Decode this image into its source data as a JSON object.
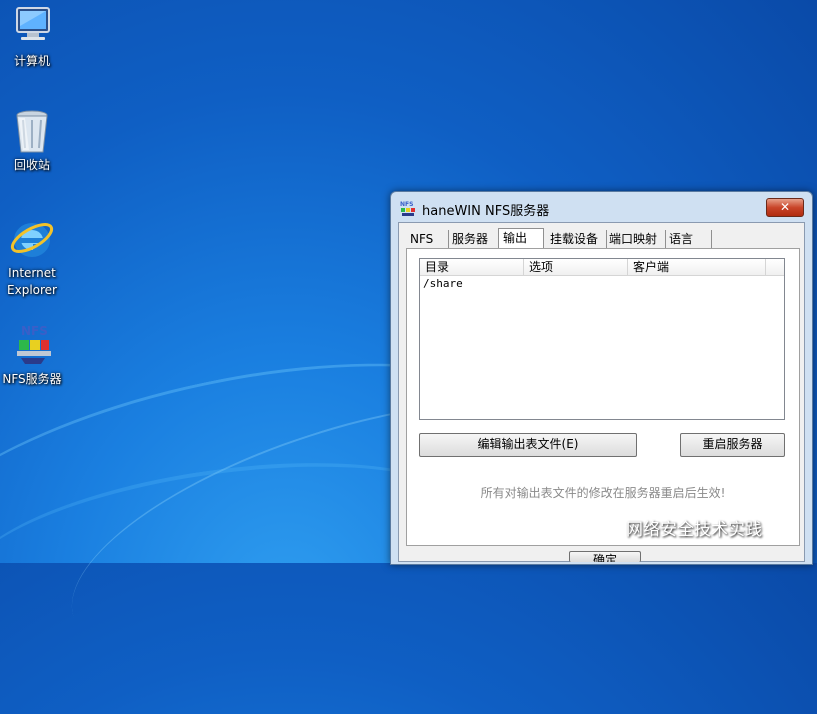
{
  "desktop": {
    "icons": [
      {
        "label": "计算机",
        "icon": "computer-icon"
      },
      {
        "label": "回收站",
        "icon": "recycle-bin-icon"
      },
      {
        "label": "Internet\nExplorer",
        "label_line1": "Internet",
        "label_line2": "Explorer",
        "icon": "internet-explorer-icon"
      },
      {
        "label": "NFS服务器",
        "icon": "nfs-server-icon"
      }
    ]
  },
  "window": {
    "title": "haneWIN NFS服务器",
    "close_label": "✕",
    "tabs": [
      {
        "label": "NFS",
        "active": false
      },
      {
        "label": "服务器",
        "active": false
      },
      {
        "label": "输出",
        "active": true
      },
      {
        "label": "挂载设备",
        "active": false
      },
      {
        "label": "端口映射",
        "active": false
      },
      {
        "label": "语言",
        "active": false
      }
    ],
    "export_table": {
      "columns": [
        "目录",
        "选项",
        "客户端"
      ],
      "rows": [
        [
          "/share",
          "",
          ""
        ]
      ]
    },
    "edit_button": "编辑输出表文件(E)",
    "restart_button": "重启服务器",
    "note": "所有对输出表文件的修改在服务器重启后生效!",
    "ok_button": "确定"
  },
  "watermark": "网络安全技术实践",
  "colors": {
    "accent": "#1a7fe0",
    "title_close": "#c9452a"
  }
}
